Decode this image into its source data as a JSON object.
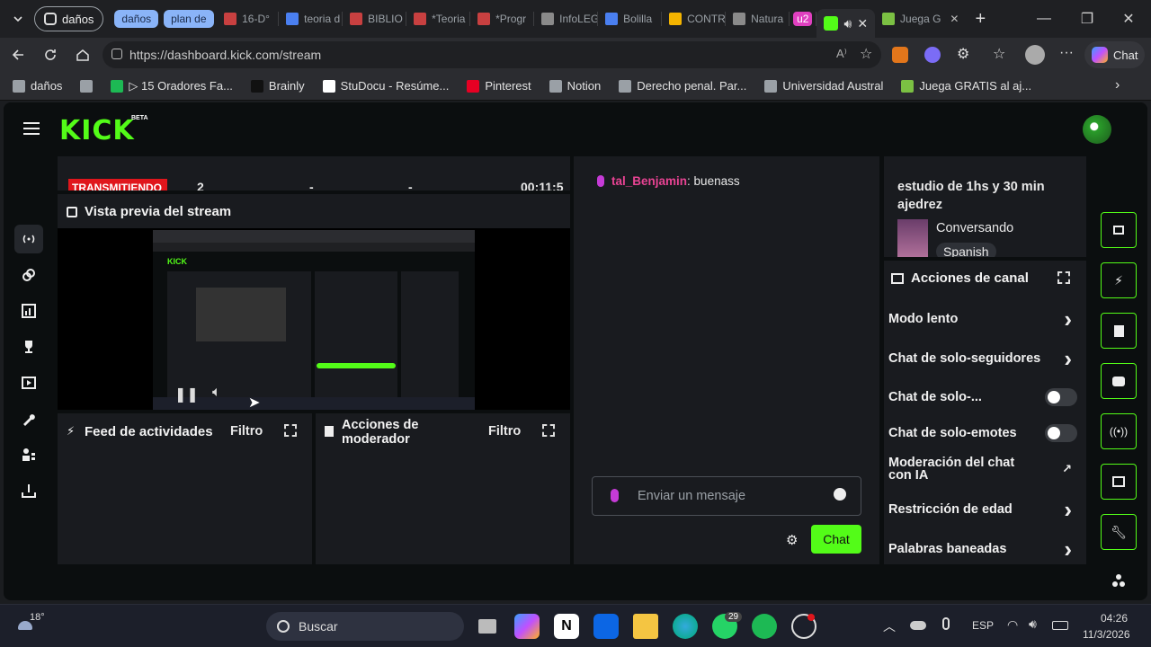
{
  "browser": {
    "profile_chip": "daños",
    "group_chips": [
      {
        "label": "daños",
        "color": "#8ab4f8"
      },
      {
        "label": "plan de",
        "color": "#8ab4f8"
      }
    ],
    "tabs": [
      {
        "label": "16-D°",
        "fav": "#c84040"
      },
      {
        "label": "teoria d",
        "fav": "#4a7ff0"
      },
      {
        "label": "BIBLIO",
        "fav": "#c84040"
      },
      {
        "label": "*Teoria",
        "fav": "#c84040"
      },
      {
        "label": "*Progr",
        "fav": "#c84040"
      },
      {
        "label": "InfoLEG",
        "fav": "#8a8a8a"
      },
      {
        "label": "Bolilla",
        "fav": "#4a7ff0"
      },
      {
        "label": "CONTR",
        "fav": "#f4b400"
      },
      {
        "label": "Natura",
        "fav": "#8a8a8a"
      },
      {
        "label": "u2",
        "fav": "#e040c0"
      },
      {
        "label": "",
        "fav": "#53fc18"
      },
      {
        "label": "Juega G",
        "fav": "#7bc043"
      }
    ],
    "url": "https://dashboard.kick.com/stream",
    "chat_button": "Chat",
    "bookmarks": [
      {
        "label": "daños",
        "fav": "#9aa0a6"
      },
      {
        "label": "",
        "fav": "#9aa0a6"
      },
      {
        "label": "▷ 15 Oradores Fa...",
        "fav": "#1db954"
      },
      {
        "label": "Brainly",
        "fav": "#111111"
      },
      {
        "label": "StuDocu - Resúme...",
        "fav": "#ffffff"
      },
      {
        "label": "Pinterest",
        "fav": "#e60023"
      },
      {
        "label": "Notion",
        "fav": "#9aa0a6"
      },
      {
        "label": "Derecho penal. Par...",
        "fav": "#9aa0a6"
      },
      {
        "label": "Universidad Austral",
        "fav": "#9aa0a6"
      },
      {
        "label": "Juega GRATIS al aj...",
        "fav": "#7bc043"
      }
    ]
  },
  "kick": {
    "logo": "KICK",
    "beta": "BETA",
    "session": {
      "status": "TRANSMITIENDO",
      "viewers": "2",
      "dash1": "-",
      "dash2": "-",
      "time": "00:11:5"
    },
    "preview": {
      "title": "Vista previa del stream"
    },
    "feed": {
      "title": "Feed de actividades",
      "filter": "Filtro"
    },
    "mod_actions": {
      "title": "Acciones de moderador",
      "filter": "Filtro"
    },
    "chat": {
      "messages": [
        {
          "user": "tal_Benjamin",
          "text": "buenass"
        }
      ],
      "input_placeholder": "Enviar un mensaje",
      "send_button": "Chat"
    },
    "stream_info": {
      "title": "estudio de 1hs y 30 min ajedrez",
      "category": "Conversando",
      "language": "Spanish"
    },
    "channel_actions": {
      "title": "Acciones de canal",
      "rows": [
        {
          "label": "Modo lento",
          "control": "chevron"
        },
        {
          "label": "Chat de solo-seguidores",
          "control": "chevron"
        },
        {
          "label": "Chat de solo-...",
          "control": "toggle"
        },
        {
          "label": "Chat de solo-emotes",
          "control": "toggle"
        },
        {
          "label": "Moderación del chat con IA",
          "control": "external"
        },
        {
          "label": "Restricción de edad",
          "control": "chevron"
        },
        {
          "label": "Palabras baneadas",
          "control": "chevron"
        }
      ]
    }
  },
  "taskbar": {
    "weather": "18°",
    "search": "Buscar",
    "whatsapp_badge": "29",
    "lang": "ESP",
    "time": "04:26",
    "date": "11/3/2026"
  },
  "colors": {
    "kick_green": "#53fc18",
    "live_red": "#e0161c",
    "chat_user": "#e84393",
    "panel": "#191b1f"
  }
}
